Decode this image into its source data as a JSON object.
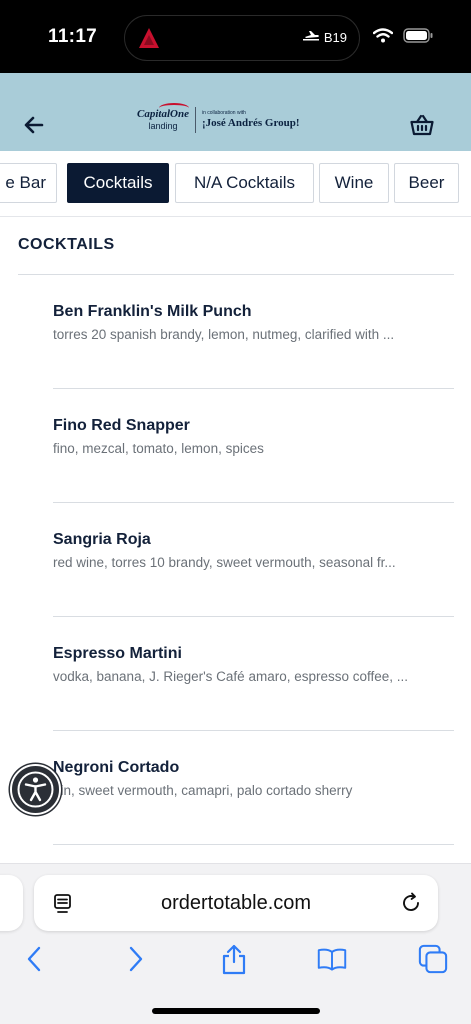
{
  "status_bar": {
    "time": "11:17",
    "flight_gate": "B19",
    "icons": [
      "airline-logo-icon",
      "airplane-icon",
      "wifi-icon",
      "battery-icon"
    ]
  },
  "header": {
    "brand_capital_one": "CapitalOne",
    "brand_landing": "landing",
    "brand_collab": "in collaboration with",
    "brand_jose_andres": "¡José Andrés Group!",
    "icons": [
      "back-arrow-icon",
      "basket-icon"
    ]
  },
  "tabs": [
    {
      "label": "e Bar",
      "active": false
    },
    {
      "label": "Cocktails",
      "active": true
    },
    {
      "label": "N/A Cocktails",
      "active": false
    },
    {
      "label": "Wine",
      "active": false
    },
    {
      "label": "Beer",
      "active": false
    }
  ],
  "section": {
    "title": "COCKTAILS"
  },
  "menu_items": [
    {
      "name": "Ben Franklin's Milk Punch",
      "description": "torres 20 spanish brandy, lemon, nutmeg, clarified with ..."
    },
    {
      "name": "Fino Red Snapper",
      "description": "fino, mezcal, tomato, lemon, spices"
    },
    {
      "name": "Sangria Roja",
      "description": "red wine, torres 10 brandy, sweet vermouth, seasonal fr..."
    },
    {
      "name": "Espresso Martini",
      "description": "vodka, banana, J. Rieger's Café amaro, espresso coffee, ..."
    },
    {
      "name": "Negroni Cortado",
      "description": "gin, sweet vermouth, camapri, palo cortado sherry"
    }
  ],
  "browser": {
    "url": "ordertotable.com",
    "icons": [
      "reader-icon",
      "reload-icon",
      "back-icon",
      "forward-icon",
      "share-icon",
      "bookmarks-icon",
      "tabs-icon"
    ]
  },
  "colors": {
    "header_bg": "#a9ccd8",
    "active_tab_bg": "#0b1a33",
    "text_primary": "#13213a",
    "text_secondary": "#6b7178",
    "browser_accent": "#2f7cf6"
  }
}
